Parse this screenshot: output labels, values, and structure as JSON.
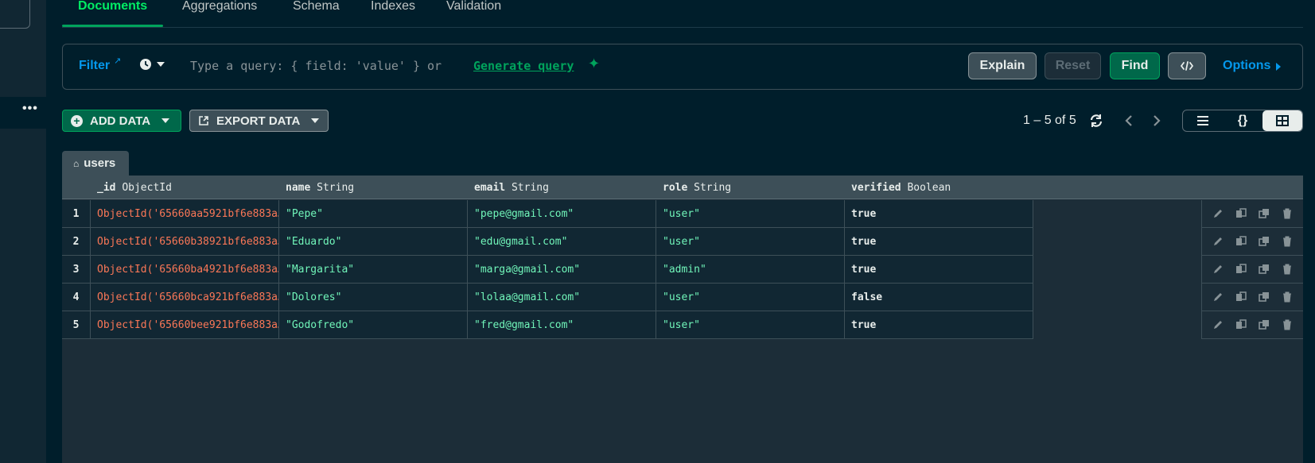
{
  "tabs": [
    "Documents",
    "Aggregations",
    "Schema",
    "Indexes",
    "Validation"
  ],
  "query": {
    "filter_label": "Filter",
    "placeholder": "Type a query: { field: 'value' } or ",
    "generate_link": "Generate query",
    "buttons": {
      "explain": "Explain",
      "reset": "Reset",
      "find": "Find"
    },
    "options": "Options"
  },
  "toolbar": {
    "add_data": "ADD DATA",
    "export_data": "EXPORT DATA",
    "pagination": "1 – 5 of 5"
  },
  "view_toggle": {
    "active": "table"
  },
  "collection_tab": "users",
  "columns": [
    {
      "name": "_id",
      "type": "ObjectId"
    },
    {
      "name": "name",
      "type": "String"
    },
    {
      "name": "email",
      "type": "String"
    },
    {
      "name": "role",
      "type": "String"
    },
    {
      "name": "verified",
      "type": "Boolean"
    }
  ],
  "rows": [
    {
      "n": "1",
      "id": "ObjectId('65660aa5921bf6e883a…",
      "name": "\"Pepe\"",
      "email": "\"pepe@gmail.com\"",
      "role": "\"user\"",
      "verified": "true"
    },
    {
      "n": "2",
      "id": "ObjectId('65660b38921bf6e883a…",
      "name": "\"Eduardo\"",
      "email": "\"edu@gmail.com\"",
      "role": "\"user\"",
      "verified": "true"
    },
    {
      "n": "3",
      "id": "ObjectId('65660ba4921bf6e883a…",
      "name": "\"Margarita\"",
      "email": "\"marga@gmail.com\"",
      "role": "\"admin\"",
      "verified": "true"
    },
    {
      "n": "4",
      "id": "ObjectId('65660bca921bf6e883a…",
      "name": "\"Dolores\"",
      "email": "\"lolaa@gmail.com\"",
      "role": "\"user\"",
      "verified": "false"
    },
    {
      "n": "5",
      "id": "ObjectId('65660bee921bf6e883a…",
      "name": "\"Godofredo\"",
      "email": "\"fred@gmail.com\"",
      "role": "\"user\"",
      "verified": "true"
    }
  ],
  "colors": {
    "accent_green": "#00ed64",
    "link_blue": "#0498ec",
    "objectid_orange": "#fa7757",
    "string_green": "#71f6ba",
    "background": "#001e2b"
  }
}
